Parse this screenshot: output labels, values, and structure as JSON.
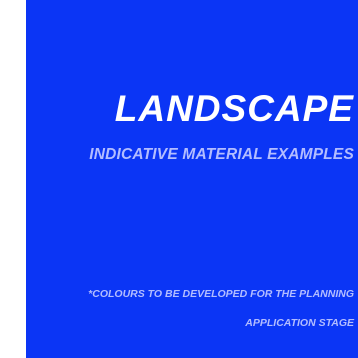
{
  "colors": {
    "panel_background": "#0b35f5",
    "title_text": "#ffffff",
    "subtitle_text": "#b3bdff",
    "note_text": "#b3bdff"
  },
  "heading": {
    "title": "LANDSCAPE",
    "subtitle": "INDICATIVE MATERIAL EXAMPLES"
  },
  "note": {
    "line1": "*COLOURS TO BE DEVELOPED FOR THE PLANNING",
    "line2": "APPLICATION STAGE"
  }
}
